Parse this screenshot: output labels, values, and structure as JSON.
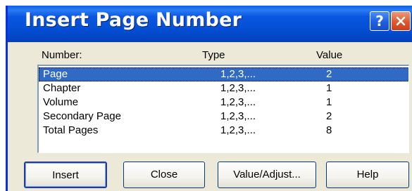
{
  "dialog": {
    "title": "Insert Page Number",
    "help_glyph": "?",
    "close_icon": "close-x-icon"
  },
  "columns": {
    "number": "Number:",
    "type": "Type",
    "value": "Value"
  },
  "rows": [
    {
      "name": "Page",
      "type": "1,2,3,...",
      "value": "2",
      "selected": true
    },
    {
      "name": "Chapter",
      "type": "1,2,3,...",
      "value": "1",
      "selected": false
    },
    {
      "name": "Volume",
      "type": "1,2,3,...",
      "value": "1",
      "selected": false
    },
    {
      "name": "Secondary Page",
      "type": "1,2,3,...",
      "value": "2",
      "selected": false
    },
    {
      "name": "Total Pages",
      "type": "1,2,3,...",
      "value": "8",
      "selected": false
    }
  ],
  "buttons": {
    "insert": "Insert",
    "close": "Close",
    "value_adjust": "Value/Adjust...",
    "help": "Help"
  },
  "colors": {
    "titlebar": "#0450d6",
    "selection": "#316ac5",
    "dialog_bg": "#ece9d8"
  }
}
